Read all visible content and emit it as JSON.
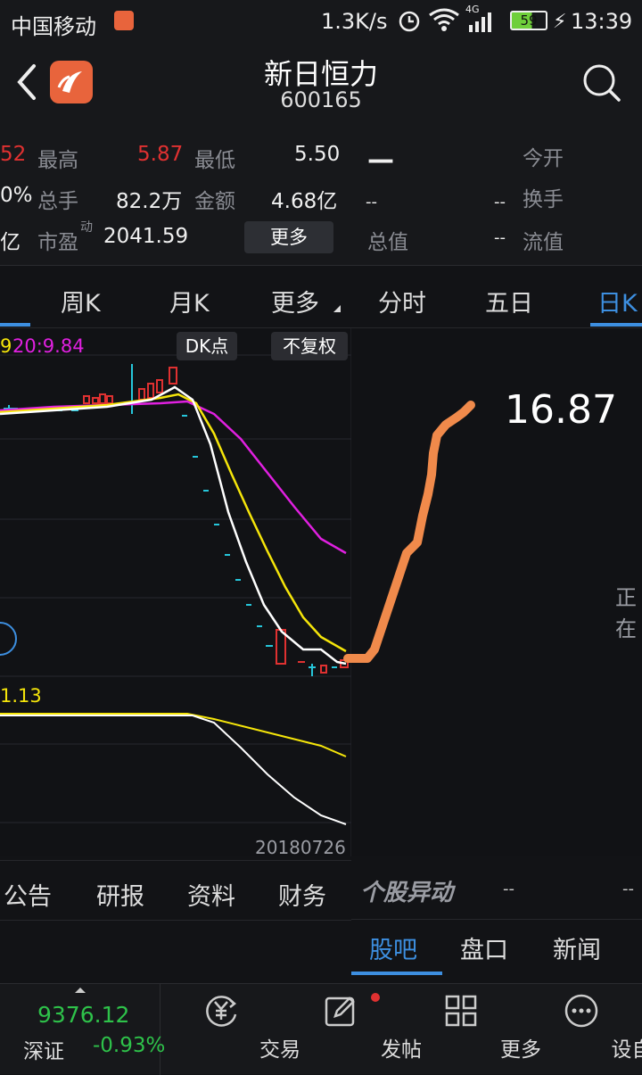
{
  "status_bar": {
    "carrier": "中国移动",
    "network_speed": "1.3K/s",
    "network_type": "4G",
    "battery": "59",
    "time": "13:39"
  },
  "header": {
    "stock_name": "新日恒力",
    "stock_code": "600165"
  },
  "quote": {
    "partial_1": "52",
    "high_label": "最高",
    "high_value": "5.87",
    "low_label": "最低",
    "low_value": "5.50",
    "partial_2": "0%",
    "volume_label": "总手",
    "volume_value": "82.2万",
    "amount_label": "金额",
    "amount_value": "4.68亿",
    "partial_3": "亿",
    "pe_label": "市盈",
    "pe_superscript": "动",
    "pe_value": "2041.59",
    "more_button": "更多",
    "dash_big": "—",
    "open_label": "今开",
    "dash_1": "--",
    "dash_2": "--",
    "turnover_label": "换手",
    "total_value_label": "总值",
    "dash_3": "--",
    "float_value_label": "流值"
  },
  "chart_tabs": {
    "weekly": "周K",
    "monthly": "月K",
    "more": "更多",
    "intraday": "分时",
    "five_day": "五日",
    "daily": "日K"
  },
  "chart": {
    "ma_text_left": "9",
    "ma_text": "20:9.84",
    "dk_button": "DK点",
    "adjust_button": "不复权",
    "lower_indicator": "1.13",
    "date_label": "20180726",
    "big_price": "16.87",
    "side_text": "正在",
    "colors": {
      "up": "#e03131",
      "down": "#26c6da",
      "ma5": "#ffffff",
      "ma10": "#f5e50a",
      "ma20": "#e020e0",
      "drawing": "#f08a4b"
    }
  },
  "info_tabs": {
    "announcement": "公告",
    "research": "研报",
    "profile": "资料",
    "finance": "财务",
    "anomaly": "个股异动",
    "dash_a": "--",
    "dash_b": "--"
  },
  "bottom_right_tabs": {
    "forum": "股吧",
    "order_book": "盘口",
    "news": "新闻"
  },
  "index": {
    "value": "9376.12",
    "name": "深证",
    "change": "-0.93%"
  },
  "nav": {
    "trade": "交易",
    "post": "发帖",
    "more": "更多",
    "watchlist": "设自选"
  }
}
